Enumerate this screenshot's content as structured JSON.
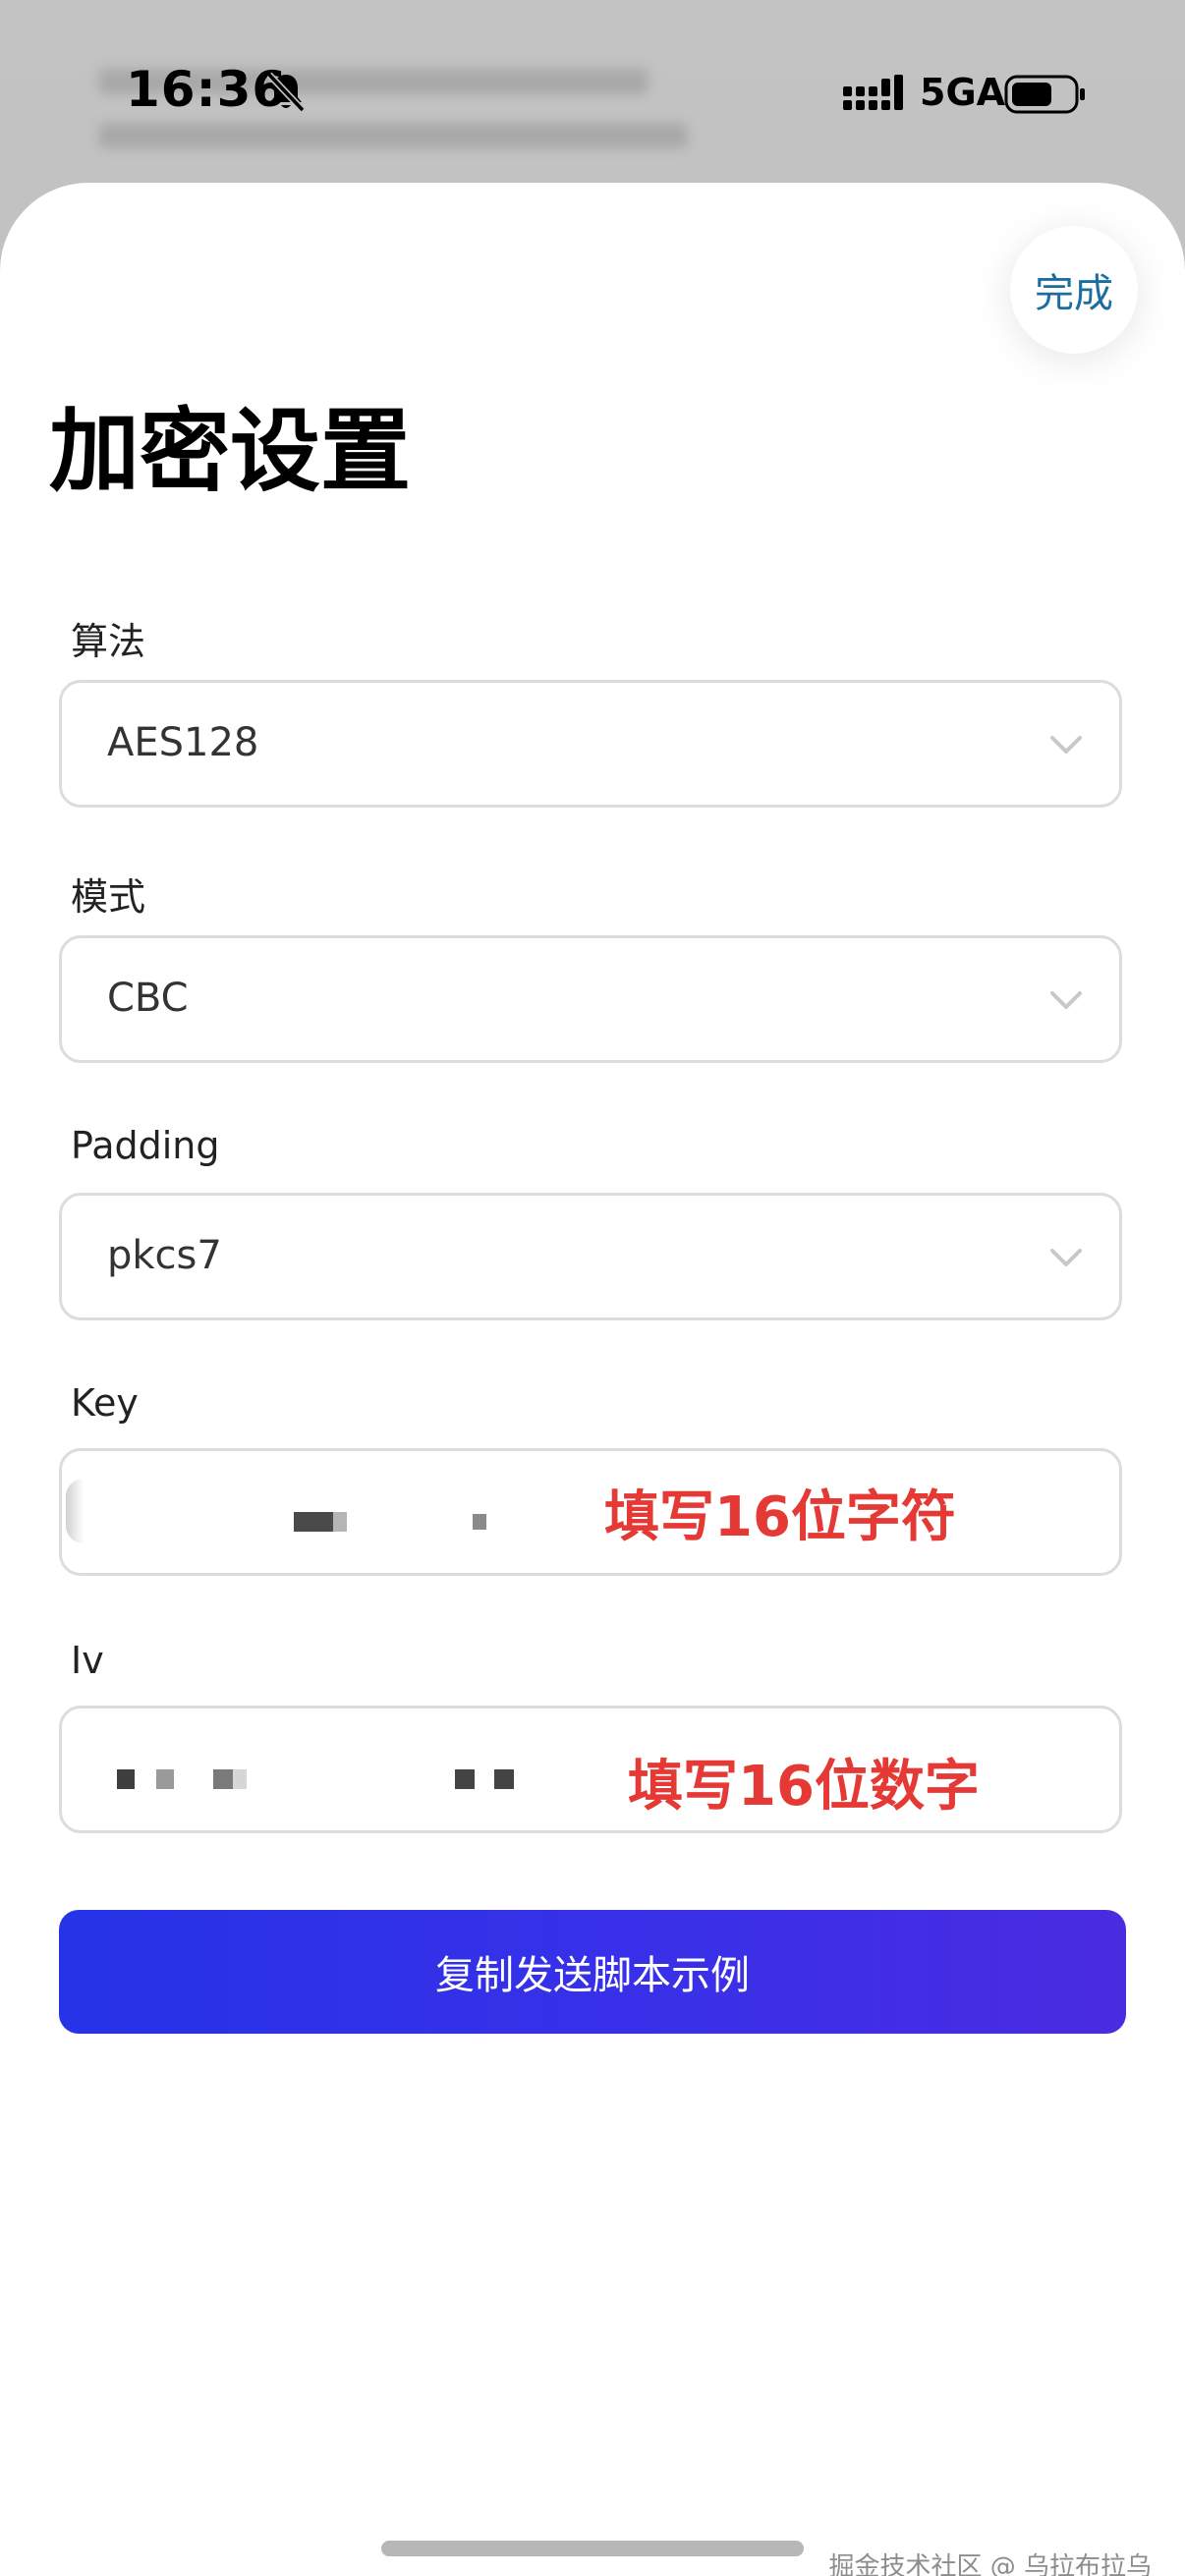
{
  "status_bar": {
    "time": "16:36",
    "network": "5GA",
    "icons": [
      "bell-slash-icon",
      "signal-icon",
      "battery-icon"
    ]
  },
  "sheet": {
    "done_label": "完成",
    "title": "加密设置",
    "fields": {
      "algorithm": {
        "label": "算法",
        "value": "AES128"
      },
      "mode": {
        "label": "模式",
        "value": "CBC"
      },
      "padding": {
        "label": "Padding",
        "value": "pkcs7"
      },
      "key": {
        "label": "Key",
        "annotation": "填写16位字符"
      },
      "iv": {
        "label": "Iv",
        "annotation": "填写16位数字"
      }
    },
    "copy_button_label": "复制发送脚本示例"
  },
  "watermark": "掘金技术社区 @ 乌拉布拉乌",
  "colors": {
    "accent": "#2633e6",
    "done_text": "#1b6fa0",
    "annotation": "#e53935",
    "border": "#dcdcdc"
  }
}
